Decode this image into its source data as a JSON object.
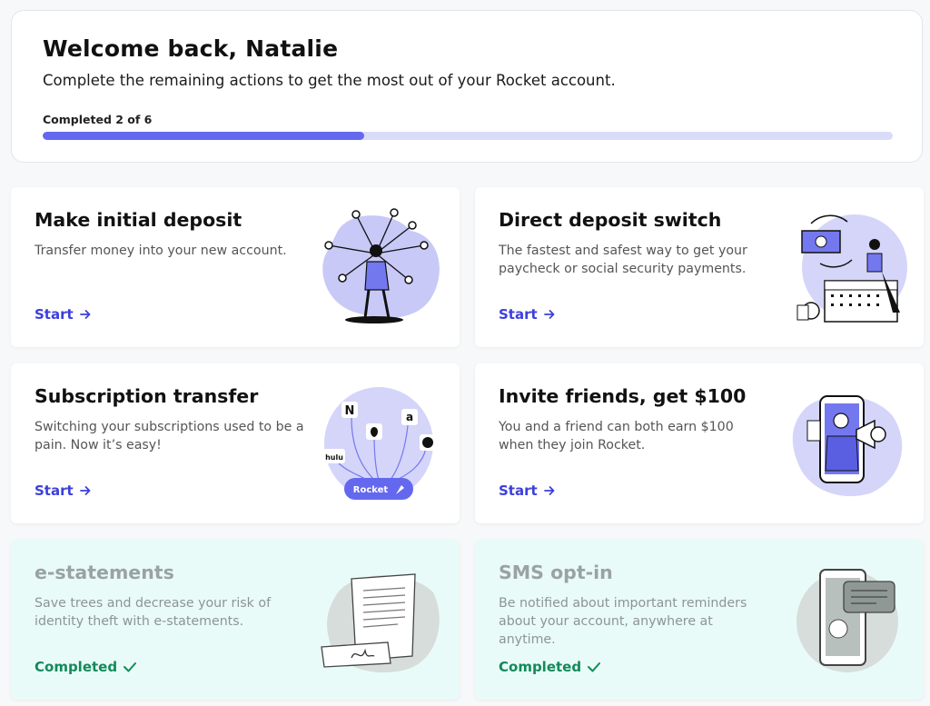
{
  "welcome": {
    "title": "Welcome back, Natalie",
    "subtitle": "Complete the remaining actions to get the most out of your Rocket account.",
    "progress_label": "Completed 2 of 6",
    "progress_fraction": 0.378
  },
  "colors": {
    "accent": "#6468ee",
    "track": "#d9dcf9",
    "link": "#3c3fdd",
    "completed": "#128a5a",
    "completed_card_bg": "#e9fbf8"
  },
  "cards": [
    {
      "title": "Make initial deposit",
      "desc": "Transfer money into your new account.",
      "action": "Start",
      "action_icon": "arrow-right-icon",
      "illustration": "network-person-illustration"
    },
    {
      "title": "Direct deposit switch",
      "desc": "The fastest and safest way to get your paycheck or social security payments.",
      "action": "Start",
      "action_icon": "arrow-right-icon",
      "illustration": "calendar-paycheck-illustration"
    },
    {
      "title": "Subscription transfer",
      "desc": "Switching your subscriptions used to be a pain. Now it’s easy!",
      "action": "Start",
      "action_icon": "arrow-right-icon",
      "illustration": "subscriptions-illustration",
      "illustration_labels": {
        "n": "N",
        "amazon": "a",
        "hulu": "hulu",
        "rocket": "Rocket"
      }
    },
    {
      "title": "Invite friends, get $100",
      "desc": "You and a friend can both earn $100 when they join Rocket.",
      "action": "Start",
      "action_icon": "arrow-right-icon",
      "illustration": "phone-megaphone-illustration"
    },
    {
      "title": "e-statements",
      "desc": "Save trees and decrease your risk of identity theft with e-statements.",
      "action": "Completed",
      "action_icon": "checkmark-icon",
      "illustration": "document-signature-illustration"
    },
    {
      "title": "SMS opt-in",
      "desc": "Be notified about important reminders about your account, anywhere at anytime.",
      "action": "Completed",
      "action_icon": "checkmark-icon",
      "illustration": "phone-message-illustration"
    }
  ]
}
